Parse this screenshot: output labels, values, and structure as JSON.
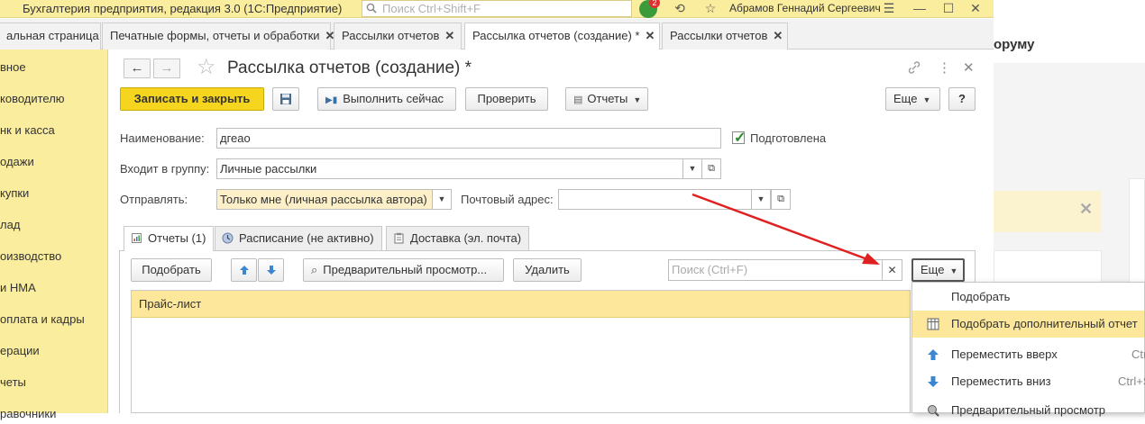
{
  "titlebar": {
    "app_title": "Бухгалтерия предприятия, редакция 3.0  (1С:Предприятие)",
    "search_placeholder": "Поиск Ctrl+Shift+F",
    "notification_count": "2",
    "user": "Абрамов Геннадий Сергеевич"
  },
  "window_tabs": [
    {
      "label": "альная страница"
    },
    {
      "label": "Печатные формы, отчеты и обработки"
    },
    {
      "label": "Рассылки отчетов"
    },
    {
      "label": "Рассылка отчетов (создание) *"
    },
    {
      "label": "Рассылки отчетов"
    }
  ],
  "sidebar": {
    "items": [
      {
        "label": "вное"
      },
      {
        "label": "ководителю"
      },
      {
        "label": "нк и касса"
      },
      {
        "label": "одажи"
      },
      {
        "label": "купки"
      },
      {
        "label": "лад"
      },
      {
        "label": "оизводство"
      },
      {
        "label": " и НМА"
      },
      {
        "label": "оплата и кадры"
      },
      {
        "label": "ерации"
      },
      {
        "label": "четы"
      },
      {
        "label": "равочники"
      }
    ]
  },
  "background": {
    "forum_text": "оруму"
  },
  "form": {
    "title": "Рассылка отчетов (создание) *",
    "toolbar": {
      "save_close": "Записать и закрыть",
      "run_now": "Выполнить сейчас",
      "check": "Проверить",
      "reports": "Отчеты",
      "more": "Еще",
      "help": "?"
    },
    "name_label": "Наименование:",
    "name_value": "дгеао",
    "prepared_label": "Подготовлена",
    "group_label": "Входит в группу:",
    "group_value": "Личные рассылки",
    "send_label": "Отправлять:",
    "send_value": "Только мне (личная рассылка автора)",
    "email_label": "Почтовый адрес:",
    "email_value": "",
    "tabs": [
      {
        "label": "Отчеты (1)"
      },
      {
        "label": "Расписание (не активно)"
      },
      {
        "label": "Доставка (эл. почта)"
      }
    ],
    "reports_toolbar": {
      "pick": "Подобрать",
      "preview": "Предварительный просмотр...",
      "delete": "Удалить",
      "search_placeholder": "Поиск (Ctrl+F)",
      "more": "Еще"
    },
    "grid_rows": [
      {
        "name": "Прайс-лист"
      }
    ]
  },
  "more_menu": {
    "items": [
      {
        "label": "Подобрать",
        "shortcut": ""
      },
      {
        "label": "Подобрать дополнительный отчет",
        "shortcut": ""
      },
      {
        "label": "Переместить вверх",
        "shortcut": "Ctr"
      },
      {
        "label": "Переместить вниз",
        "shortcut": "Ctrl+S"
      },
      {
        "label": "Предварительный просмотр",
        "shortcut": ""
      }
    ]
  },
  "colors": {
    "accent_yellow": "#f6d51e",
    "panel_yellow": "#fbed9e",
    "selection": "#fde79a",
    "annotation_arrow": "#e02020"
  }
}
